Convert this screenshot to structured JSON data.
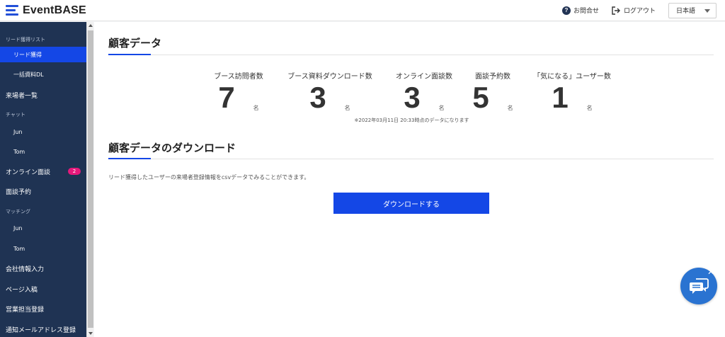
{
  "header": {
    "brand": "EventBASE",
    "contact_label": "お問合せ",
    "logout_label": "ログアウト",
    "language": "日本語"
  },
  "sidebar": {
    "items": [
      {
        "label": "リード獲得リスト",
        "type": "category"
      },
      {
        "label": "リード獲得",
        "type": "sub",
        "active": true
      },
      {
        "label": "一括資料DL",
        "type": "sub"
      },
      {
        "label": "来場者一覧",
        "type": "item"
      },
      {
        "label": "チャット",
        "type": "category"
      },
      {
        "label": "Jun",
        "type": "sub"
      },
      {
        "label": "Tom",
        "type": "sub"
      },
      {
        "label": "オンライン面談",
        "type": "item",
        "badge": "2"
      },
      {
        "label": "面談予約",
        "type": "item"
      },
      {
        "label": "マッチング",
        "type": "category"
      },
      {
        "label": "Jun",
        "type": "sub"
      },
      {
        "label": "Tom",
        "type": "sub"
      },
      {
        "label": "会社情報入力",
        "type": "item"
      },
      {
        "label": "ページ入稿",
        "type": "item"
      },
      {
        "label": "営業担当登録",
        "type": "item"
      },
      {
        "label": "通知メールアドレス登録",
        "type": "item"
      }
    ]
  },
  "customer_data": {
    "title": "顧客データ",
    "stats": [
      {
        "label": "ブース訪問者数",
        "value": "7",
        "unit": "名"
      },
      {
        "label": "ブース資料ダウンロード数",
        "value": "3",
        "unit": "名"
      },
      {
        "label": "オンライン面談数",
        "value": "3",
        "unit": "名"
      },
      {
        "label": "面談予約数",
        "value": "5",
        "unit": "名"
      },
      {
        "label": "「気になる」ユーザー数",
        "value": "1",
        "unit": "名"
      }
    ],
    "note": "※2022年03月11日 20:33時点のデータになります"
  },
  "download": {
    "title": "顧客データのダウンロード",
    "description": "リード獲得したユーザーの来場者登録情報をcsvデータでみることができます。",
    "button_label": "ダウンロードする"
  },
  "colors": {
    "sidebar_bg": "#1f3353",
    "accent": "#1447e6",
    "badge": "#e5197b",
    "chat": "#2a73d1"
  }
}
